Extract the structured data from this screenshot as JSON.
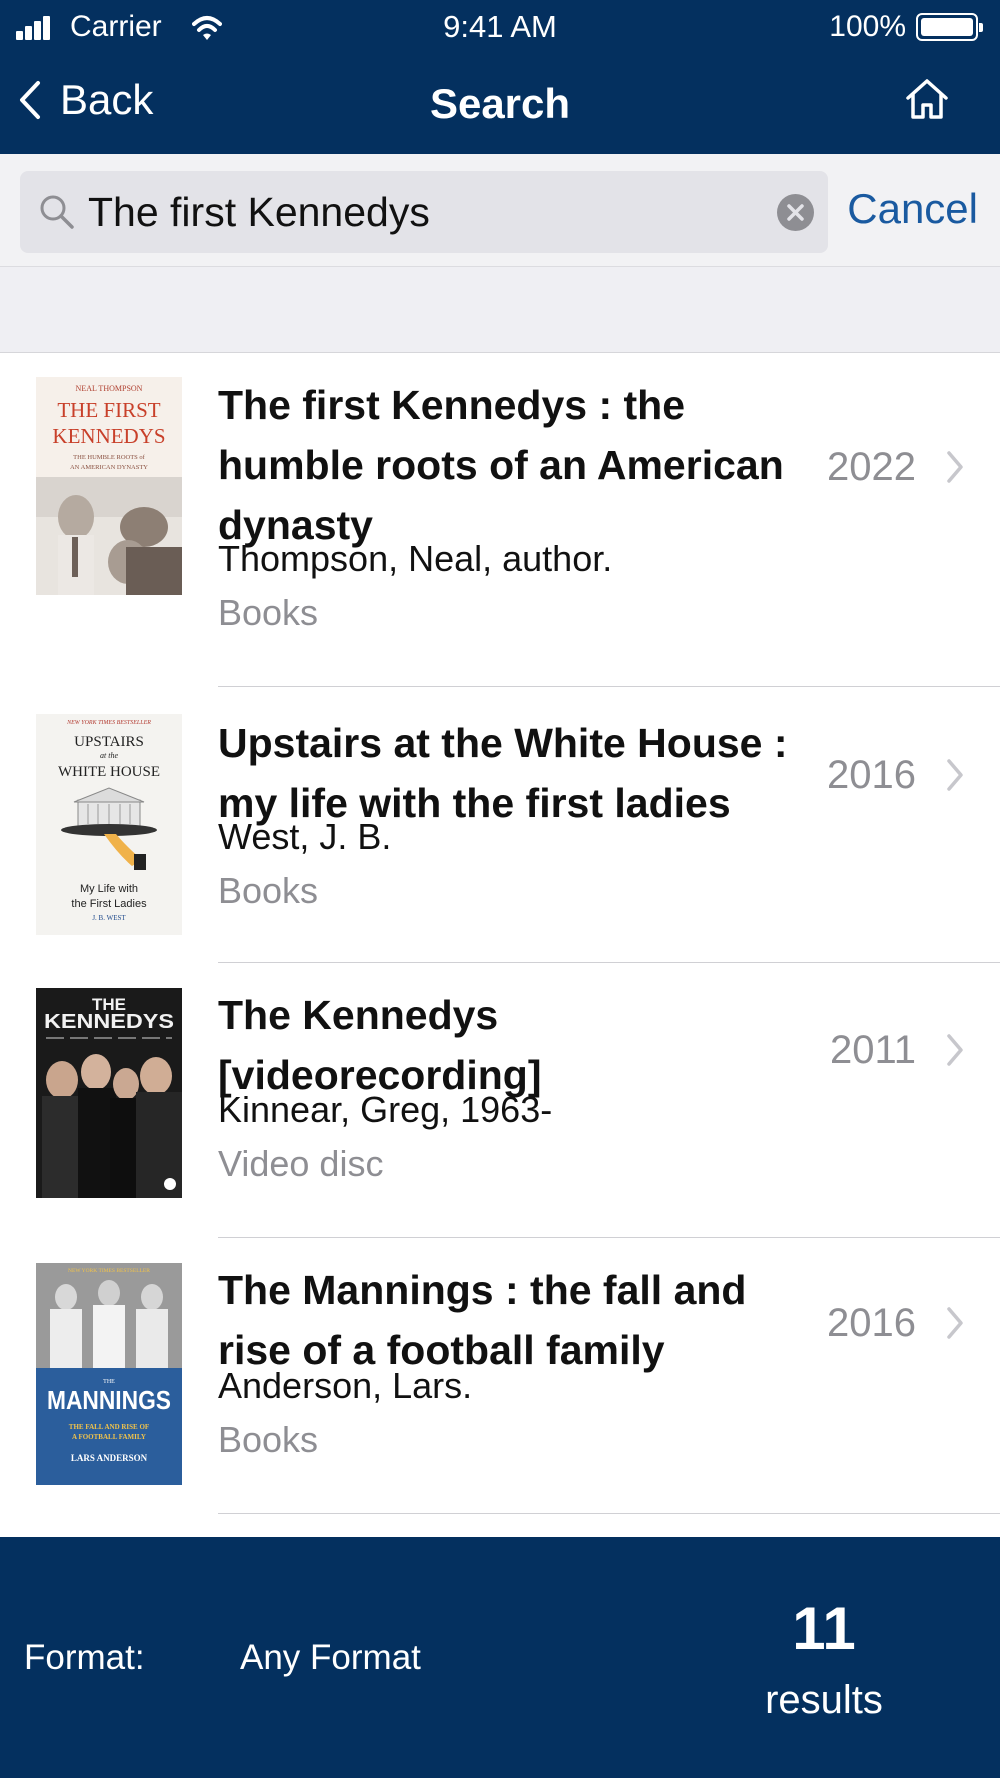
{
  "status_bar": {
    "carrier": "Carrier",
    "time": "9:41 AM",
    "battery": "100%"
  },
  "nav": {
    "back_label": "Back",
    "title": "Search",
    "home_icon": "home-icon"
  },
  "search": {
    "query": "The first Kennedys",
    "cancel_label": "Cancel"
  },
  "results": [
    {
      "title": "The first Kennedys : the humble roots of an American dynasty",
      "author": "Thompson, Neal, author.",
      "format": "Books",
      "year": "2022",
      "cover": {
        "author": "NEAL THOMPSON",
        "title_1": "THE FIRST",
        "title_2": "KENNEDYS",
        "subtitle_1": "THE HUMBLE ROOTS of",
        "subtitle_2": "AN AMERICAN DYNASTY"
      }
    },
    {
      "title": "Upstairs at the White House : my life with the first ladies",
      "author": "West, J. B.",
      "format": "Books",
      "year": "2016",
      "cover": {
        "banner": "NEW YORK TIMES BESTSELLER",
        "title_1": "UPSTAIRS",
        "title_mid": "at the",
        "title_2": "WHITE HOUSE",
        "subtitle_1": "My Life with",
        "subtitle_2": "the First Ladies",
        "author": "J. B. WEST"
      }
    },
    {
      "title": "The Kennedys [videorecording]",
      "author": "Kinnear, Greg, 1963-",
      "format": "Video disc",
      "year": "2011",
      "cover": {
        "title_1": "THE",
        "title_2": "KENNEDYS"
      }
    },
    {
      "title": "The Mannings : the fall and rise of a football family",
      "author": "Anderson, Lars.",
      "format": "Books",
      "year": "2016",
      "cover": {
        "banner": "NEW YORK TIMES BESTSELLER",
        "small": "THE",
        "title": "MANNINGS",
        "subtitle_1": "THE FALL AND RISE OF",
        "subtitle_2": "A FOOTBALL FAMILY",
        "author": "LARS ANDERSON"
      }
    }
  ],
  "footer": {
    "format_label": "Format:",
    "format_value": "Any Format",
    "count": "11",
    "count_label": "results"
  },
  "colors": {
    "navy": "#04305f",
    "accent": "#1a5aa0",
    "muted": "#8e8e93"
  }
}
